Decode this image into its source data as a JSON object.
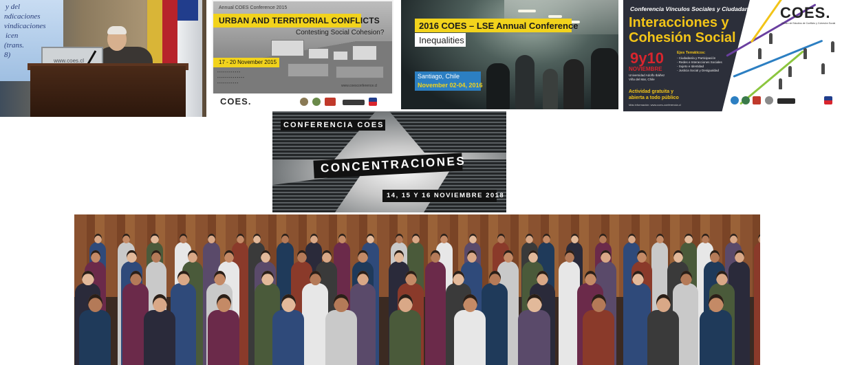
{
  "panel1": {
    "screen_lines": [
      "y del",
      "ndicaciones",
      "vindicaciones",
      "icen",
      "(trans.",
      "8)"
    ],
    "monitor_text": "www.coes.cl"
  },
  "panel2": {
    "annual": "Annual COES Conference 2015",
    "title": "URBAN AND TERRITORIAL CONFLICTS",
    "subtitle": "Contesting Social Cohesion?",
    "dates": "17 - 20 November 2015",
    "url": "www.coesconference.cl",
    "logo_text": "COES."
  },
  "panel3": {
    "title": "2016 COES – LSE Annual Conference",
    "subtitle": "Inequalities",
    "city": "Santiago, Chile",
    "dates": "November 02-04, 2016"
  },
  "panel4": {
    "conference": "Conferencia Vínculos Sociales y Ciudadanía:",
    "title_line1": "Interacciones y",
    "title_line2": "Cohesión Social",
    "date": "9y10",
    "month": "NOVIEMBRE",
    "venue1": "Universidad Adolfo Ibáñez",
    "venue2": "Viña del Mar, Chile",
    "ejes_title": "Ejes Temáticos:",
    "ejes": [
      "- Ciudadanía y Participación",
      "- Redes e Interacciones Sociales",
      "- Sujeto e Identidad",
      "- Justicia Social y Desigualdad"
    ],
    "activity1": "Actividad gratuita y",
    "activity2": "abierta a todo público",
    "more_info": "Más información: www.coes-conferencia.cl",
    "logo_text": "COES.",
    "logo_sub": "Centro de Estudios de Conflicto y Cohesión Social"
  },
  "panel5": {
    "conference": "CONFERENCIA COES",
    "title": "CONCENTRACIONES",
    "dates": "14, 15 Y 16 NOVIEMBRE 2018"
  }
}
